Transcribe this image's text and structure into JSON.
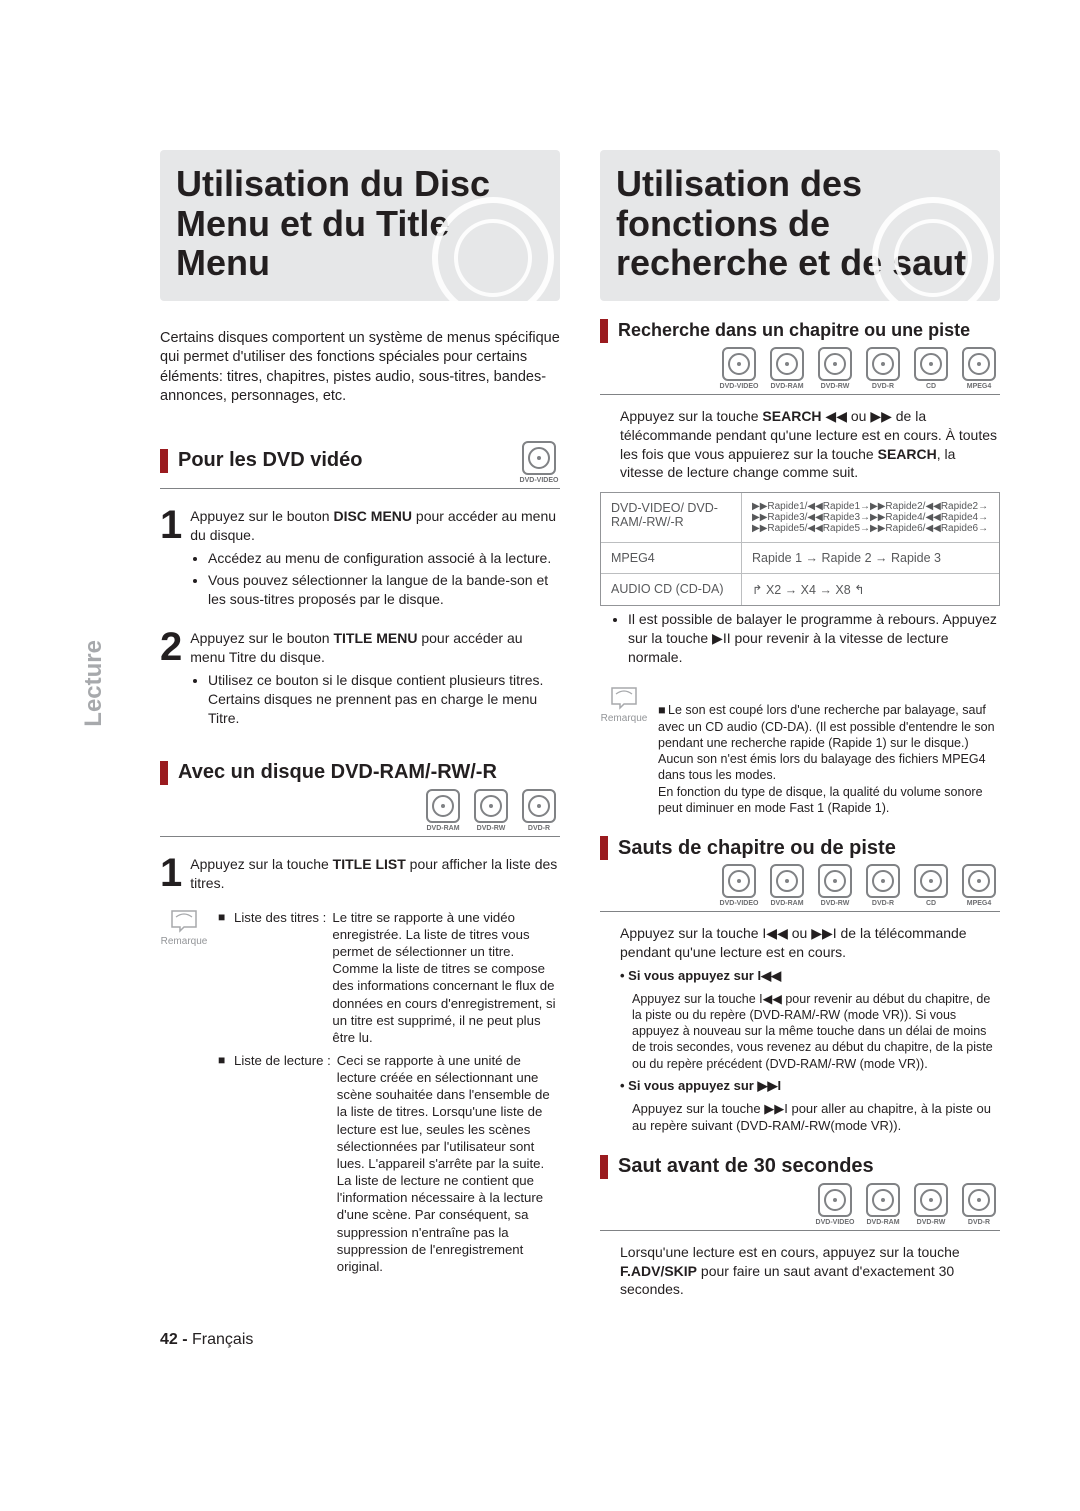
{
  "sidebar": {
    "label": "Lecture"
  },
  "left": {
    "title": "Utilisation du Disc Menu et du Title Menu",
    "intro": "Certains disques comportent un système de menus spécifique qui permet d'utiliser des fonctions spéciales pour certains éléments: titres, chapitres, pistes audio, sous-titres, bandes-annonces, personnages, etc.",
    "sec1": {
      "title": "Pour les DVD vidéo",
      "discs": [
        "DVD-VIDEO"
      ],
      "step1_pre": "Appuyez sur le bouton ",
      "step1_bold": "DISC MENU",
      "step1_post": " pour accéder au menu du disque.",
      "step1_bul1": "Accédez au menu de configuration associé à la lecture.",
      "step1_bul2": "Vous pouvez sélectionner la langue de la bande-son et les sous-titres proposés par le disque.",
      "step2_pre": "Appuyez sur le bouton ",
      "step2_bold": "TITLE MENU",
      "step2_post": " pour accéder au menu Titre du disque.",
      "step2_bul1": "Utilisez ce bouton si le disque contient plusieurs titres. Certains disques ne prennent pas en charge le menu Titre."
    },
    "sec2": {
      "title": "Avec un disque DVD-RAM/-RW/-R",
      "discs": [
        "DVD-RAM",
        "DVD-RW",
        "DVD-R"
      ],
      "step1_pre": "Appuyez sur la touche ",
      "step1_bold": "TITLE LIST",
      "step1_post": " pour afficher la liste des titres.",
      "note_label1": "Liste des titres :",
      "note_val1": "Le titre se rapporte à une vidéo enregistrée. La liste de titres vous permet de sélectionner un titre. Comme la liste de titres se compose des informations concernant le flux de données en cours d'enregistrement, si un titre est supprimé, il ne peut plus être lu.",
      "note_label2": "Liste de lecture :",
      "note_val2": "Ceci se rapporte à une unité de lecture créée en sélectionnant une scène souhaitée dans l'ensemble de la liste de titres. Lorsqu'une liste de lecture est lue, seules les scènes sélectionnées par l'utilisateur sont lues. L'appareil s'arrête par la suite. La liste de lecture ne contient que l'information nécessaire à la lecture d'une scène. Par conséquent, sa suppression n'entraîne pas la suppression de l'enregistrement original.",
      "remark": "Remarque"
    },
    "footer_num": "42 - ",
    "footer_lang": "Français"
  },
  "right": {
    "title": "Utilisation des fonctions de recherche et de saut",
    "sec1": {
      "title": "Recherche dans un chapitre ou une piste",
      "discs": [
        "DVD-VIDEO",
        "DVD-RAM",
        "DVD-RW",
        "DVD-R",
        "CD",
        "MPEG4"
      ],
      "p1_pre": "Appuyez sur la touche ",
      "p1_bold": "SEARCH",
      "p1_sym": " ◀◀ ou ▶▶ ",
      "p1_post1": "de la télécommande pendant qu'une lecture est en cours. À toutes les fois que vous appuierez sur la touche ",
      "p1_post2": ", la vitesse de lecture change comme suit.",
      "tbl": [
        {
          "l": "DVD-VIDEO/ DVD-RAM/-RW/-R",
          "r": "▶▶Rapide1/◀◀Rapide1→▶▶Rapide2/◀◀Rapide2→ ▶▶Rapide3/◀◀Rapide3→▶▶Rapide4/◀◀Rapide4→ ▶▶Rapide5/◀◀Rapide5→▶▶Rapide6/◀◀Rapide6→"
        },
        {
          "l": "MPEG4",
          "r": "Rapide 1 → Rapide 2 → Rapide 3"
        },
        {
          "l": "AUDIO CD (CD-DA)",
          "r": "↱ X2 → X4 → X8 ↰"
        }
      ],
      "bul1": "Il est possible de balayer le programme à rebours. Appuyez sur la touche ▶II pour revenir à la vitesse de lecture normale.",
      "note": "Le son est coupé lors d'une recherche par balayage, sauf avec un CD audio (CD-DA). (Il est possible d'entendre le son pendant une recherche rapide (Rapide 1) sur le disque.) Aucun son n'est émis lors du balayage des fichiers MPEG4 dans tous les modes.\nEn fonction du type de disque, la qualité du volume sonore peut diminuer en mode Fast 1 (Rapide 1).",
      "remark": "Remarque"
    },
    "sec2": {
      "title": "Sauts de chapitre ou de piste",
      "discs": [
        "DVD-VIDEO",
        "DVD-RAM",
        "DVD-RW",
        "DVD-R",
        "CD",
        "MPEG4"
      ],
      "p1": "Appuyez sur la touche I◀◀ ou ▶▶I de la télécommande pendant qu'une lecture est en cours.",
      "s1_head": "• Si vous appuyez sur I◀◀",
      "s1_body": "Appuyez sur la touche I◀◀ pour revenir au début du chapitre, de la piste ou du repère (DVD-RAM/-RW (mode VR)). Si vous appuyez à nouveau sur la même touche dans un délai de moins de trois secondes, vous revenez au début du chapitre, de la piste ou du repère précédent (DVD-RAM/-RW (mode VR)).",
      "s2_head": "• Si vous appuyez sur ▶▶I",
      "s2_body": "Appuyez sur la touche ▶▶I pour aller au chapitre, à la piste ou au repère suivant (DVD-RAM/-RW(mode VR))."
    },
    "sec3": {
      "title": "Saut avant de 30 secondes",
      "discs": [
        "DVD-VIDEO",
        "DVD-RAM",
        "DVD-RW",
        "DVD-R"
      ],
      "p1_pre": "Lorsqu'une lecture est en cours, appuyez sur la touche ",
      "p1_bold": "F.ADV/SKIP",
      "p1_post": " pour faire un saut avant d'exactement 30 secondes."
    }
  }
}
